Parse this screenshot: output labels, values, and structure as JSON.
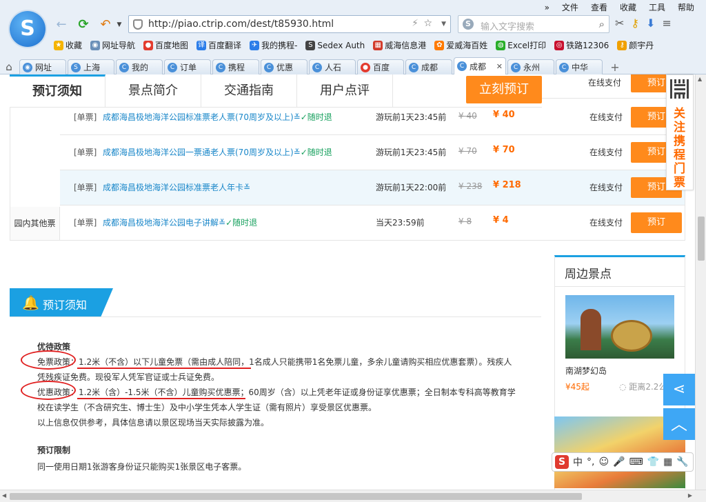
{
  "browser": {
    "menu": [
      "»",
      "文件",
      "查看",
      "收藏",
      "工具",
      "帮助"
    ],
    "url": "http://piao.ctrip.com/dest/t85930.html",
    "search_placeholder": "输入文字搜索",
    "bookmarks": [
      {
        "label": "收藏",
        "icon": "star-icon",
        "color": "#f5b400"
      },
      {
        "label": "网址导航",
        "icon": "globe-icon",
        "color": "#6a8fb8"
      },
      {
        "label": "百度地图",
        "icon": "map-pin-icon",
        "color": "#e33b2e"
      },
      {
        "label": "百度翻译",
        "icon": "translate-icon",
        "color": "#2b7de9"
      },
      {
        "label": "我的携程-",
        "icon": "ctrip-icon",
        "color": "#2b7de9"
      },
      {
        "label": "Sedex Auth",
        "icon": "sedex-icon",
        "color": "#444444"
      },
      {
        "label": "威海信息港",
        "icon": "grid-icon",
        "color": "#d23a2a"
      },
      {
        "label": "爱威海百姓",
        "icon": "paw-icon",
        "color": "#ff7a00"
      },
      {
        "label": "Excel打印",
        "icon": "wechat-icon",
        "color": "#2aae2a"
      },
      {
        "label": "铁路12306",
        "icon": "rail-icon",
        "color": "#c8102e"
      },
      {
        "label": "颜宇丹",
        "icon": "key-icon",
        "color": "#f0a000"
      }
    ],
    "tabs": [
      {
        "label": "网址",
        "active": false
      },
      {
        "label": "上海",
        "active": false
      },
      {
        "label": "我的",
        "active": false
      },
      {
        "label": "订单",
        "active": false
      },
      {
        "label": "携程",
        "active": false
      },
      {
        "label": "优惠",
        "active": false
      },
      {
        "label": "人石",
        "active": false
      },
      {
        "label": "百度",
        "active": false
      },
      {
        "label": "成都",
        "active": false
      },
      {
        "label": "成都",
        "active": true
      },
      {
        "label": "永州",
        "active": false
      },
      {
        "label": "中华",
        "active": false
      }
    ]
  },
  "page": {
    "sticky_tabs": [
      "预订须知",
      "景点简介",
      "交通指南",
      "用户点评"
    ],
    "buy_button": "立刻预订",
    "top_row": {
      "pay": "在线支付",
      "book": "预订"
    },
    "tickets": [
      {
        "type": "[单票]",
        "name": "成都海昌极地海洋公园标准票老人票(70周岁及以上)",
        "refund": "随时退",
        "time": "游玩前1天23:45前",
        "orig": "¥ 40",
        "price": "¥ 40",
        "pay": "在线支付",
        "book": "预订",
        "highlight": false
      },
      {
        "type": "[单票]",
        "name": "成都海昌极地海洋公园一票通老人票(70周岁及以上)",
        "refund": "随时退",
        "time": "游玩前1天23:45前",
        "orig": "¥ 70",
        "price": "¥ 70",
        "pay": "在线支付",
        "book": "预订",
        "highlight": false
      },
      {
        "type": "[单票]",
        "name": "成都海昌极地海洋公园标准票老人年卡",
        "refund": "",
        "time": "游玩前1天22:00前",
        "orig": "¥ 238",
        "price": "¥ 218",
        "pay": "在线支付",
        "book": "预订",
        "highlight": true
      },
      {
        "type": "[单票]",
        "name": "成都海昌极地海洋公园电子讲解",
        "refund": "随时退",
        "time": "当天23:59前",
        "orig": "¥ 8",
        "price": "¥ 4",
        "pay": "在线支付",
        "book": "预订",
        "highlight": false
      }
    ],
    "other_category": "园内其他票",
    "notice": {
      "header": "预订须知",
      "policy_title": "优待政策",
      "free_label": "免票政策",
      "free_text": "：1.2米（不含）以下儿童免票（需由成人陪同，1名成人只能携带1名免票儿童，多余儿童请购买相应优惠套票）。残疾人凭残疾证免费。现役军人凭军官证或士兵证免费。",
      "discount_label": "优惠政策",
      "discount_text": "：1.2米（含）-1.5米（不含）儿童购买优惠票；60周岁（含）以上凭老年证或身份证享优惠票；全日制本专科高等教育学校在读学生（不含研究生、博士生）及中小学生凭本人学生证（需有照片）享受景区优惠票。",
      "disclaimer": "以上信息仅供参考，具体信息请以景区现场当天实际披露为准。",
      "limit_title": "预订限制",
      "limit_text": "同一使用日期1张游客身份证只能购买1张景区电子客票。"
    },
    "nearby": {
      "title": "周边景点",
      "spot_name": "南湖梦幻岛",
      "spot_price": "¥45起",
      "spot_distance": "距离2.2公里"
    },
    "follow_text": "关注携程门票"
  }
}
